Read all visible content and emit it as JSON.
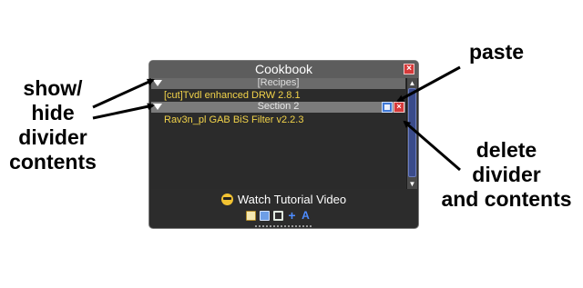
{
  "annotations": {
    "show_hide": [
      "show/",
      "hide",
      "divider",
      "contents"
    ],
    "paste": "paste",
    "delete": [
      "delete",
      "divider",
      "and contents"
    ]
  },
  "window": {
    "title": "Cookbook",
    "close_icon": "close-icon"
  },
  "list": {
    "dividers": [
      {
        "label": "[Recipes]",
        "icon": "triangle-down-icon"
      },
      {
        "label": "Section 2",
        "icon": "triangle-down-icon"
      }
    ],
    "items": [
      {
        "label": "[cut]Tvdl enhanced DRW 2.8.1"
      },
      {
        "label": "Rav3n_pl GAB BiS Filter v2.2.3"
      }
    ]
  },
  "footer": {
    "tutorial_label": "Watch Tutorial Video",
    "tool_icons": [
      "edit-icon",
      "copy-icon",
      "import-icon",
      "add-icon",
      "font-icon"
    ]
  },
  "colors": {
    "window_bg": "#2c2c2c",
    "titlebar": "#5d5d5d",
    "item_text": "#f2d34a",
    "delete": "#d63a3a",
    "paste": "#3f78d6",
    "scroll_thumb": "#3a4b8a"
  }
}
